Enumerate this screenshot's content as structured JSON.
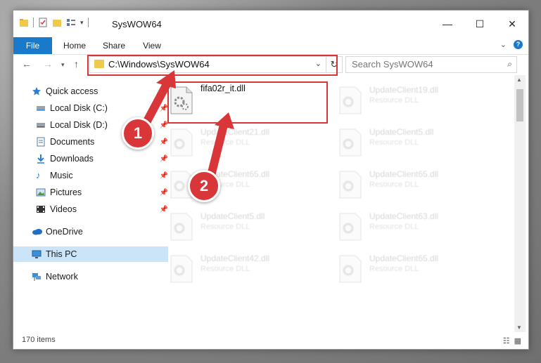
{
  "window": {
    "title": "SysWOW64"
  },
  "ribbon": {
    "tabs": [
      "File",
      "Home",
      "Share",
      "View"
    ]
  },
  "nav": {
    "address_path": "C:\\Windows\\SysWOW64",
    "search_placeholder": "Search SysWOW64"
  },
  "sidebar": {
    "items": [
      {
        "label": "Quick access",
        "icon": "star-icon",
        "pinned": false
      },
      {
        "label": "Local Disk (C:)",
        "icon": "drive-icon",
        "pinned": true
      },
      {
        "label": "Local Disk (D:)",
        "icon": "drive-icon",
        "pinned": true
      },
      {
        "label": "Documents",
        "icon": "document-icon",
        "pinned": true
      },
      {
        "label": "Downloads",
        "icon": "download-icon",
        "pinned": true
      },
      {
        "label": "Music",
        "icon": "music-icon",
        "pinned": true
      },
      {
        "label": "Pictures",
        "icon": "pictures-icon",
        "pinned": true
      },
      {
        "label": "Videos",
        "icon": "video-icon",
        "pinned": true
      },
      {
        "label": "OneDrive",
        "icon": "cloud-icon",
        "pinned": false
      },
      {
        "label": "This PC",
        "icon": "computer-icon",
        "pinned": false,
        "selected": true
      },
      {
        "label": "Network",
        "icon": "network-icon",
        "pinned": false
      }
    ]
  },
  "files": {
    "highlighted": {
      "name": "fifa02r_it.dll"
    },
    "faded": [
      {
        "name": "UpdateClient19.dll",
        "type": "Resource DLL"
      },
      {
        "name": "UpdateClient21.dll",
        "type": "Resource DLL"
      },
      {
        "name": "UpdateClient5.dll",
        "type": "Resource DLL"
      },
      {
        "name": "UpdateClient65.dll",
        "type": "Resource DLL"
      },
      {
        "name": "UpdateClient65.dll",
        "type": "Resource DLL"
      },
      {
        "name": "UpdateClient5.dll",
        "type": "Resource DLL"
      },
      {
        "name": "UpdateClient63.dll",
        "type": "Resource DLL"
      },
      {
        "name": "UpdateClient42.dll",
        "type": "Resource DLL"
      },
      {
        "name": "UpdateClient65.dll",
        "type": "Resource DLL"
      }
    ]
  },
  "status": {
    "item_count": "170 items"
  },
  "callouts": [
    "1",
    "2"
  ],
  "colors": {
    "accent": "#1979ca",
    "highlight": "#d9363a",
    "selected": "#cce4f7"
  }
}
